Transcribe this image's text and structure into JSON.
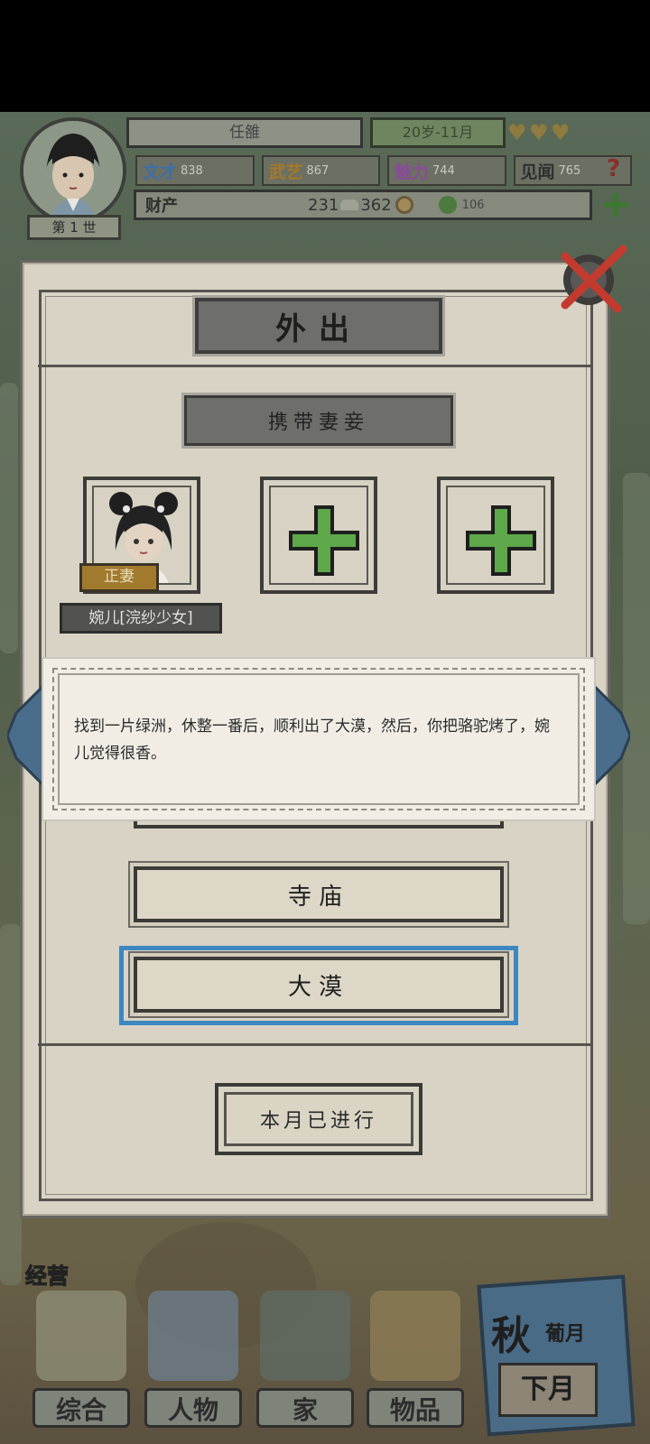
{
  "header": {
    "character_name": "任雒",
    "age": "20岁-11月",
    "generation": "第 1 世",
    "stats": [
      {
        "label": "文才",
        "value": "838",
        "color": "#3c6fa6"
      },
      {
        "label": "武艺",
        "value": "867",
        "color": "#a5782a"
      },
      {
        "label": "魅力",
        "value": "744",
        "color": "#8b4a9a"
      },
      {
        "label": "见闻",
        "value": "765",
        "color": "#2f2f2f"
      }
    ],
    "wealth_label": "财产",
    "silver": "231",
    "coins": "362",
    "jade": "106"
  },
  "dialog": {
    "title": "外出",
    "companion_section": "携带妻妾",
    "wife_badge": "正妻",
    "wife_name": "婉儿[浣纱少女]"
  },
  "event": {
    "text": "找到一片绿洲，休整一番后，顺利出了大漠，然后，你把骆驼烤了，婉儿觉得很香。"
  },
  "options": {
    "temple": "寺庙",
    "desert": "大漠"
  },
  "done_button": "本月已进行",
  "nav": {
    "manage_label": "经营",
    "items": [
      "综合",
      "人物",
      "家",
      "物品"
    ],
    "season": "秋",
    "season_sub": "葡月",
    "next_month": "下月"
  },
  "colors": {
    "selected_border": "#3e86c0",
    "plus_green": "#5ea84a"
  }
}
